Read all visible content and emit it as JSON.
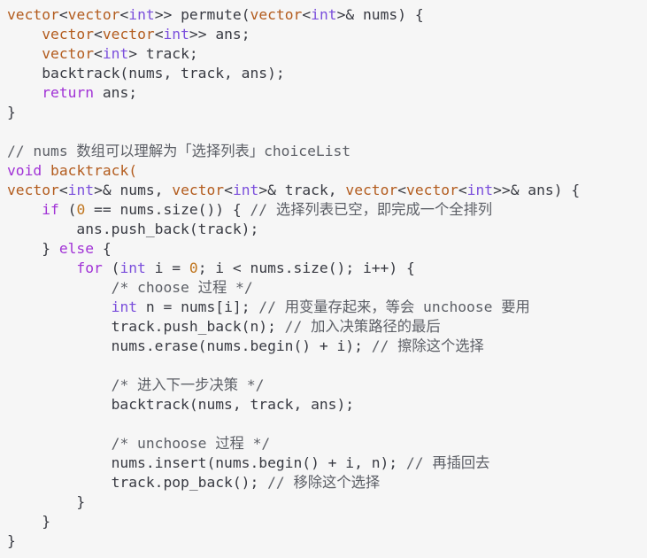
{
  "colors": {
    "background": "#f6f6f6",
    "type": "#b35c1e",
    "keyword": "#a132d6",
    "builtin": "#7b4fdc",
    "comment": "#5c5f66",
    "text": "#383a42",
    "number": "#c0761f"
  },
  "lines": [
    [
      {
        "t": "vector",
        "c": "type"
      },
      {
        "t": "<",
        "c": "plain"
      },
      {
        "t": "vector",
        "c": "type"
      },
      {
        "t": "<",
        "c": "plain"
      },
      {
        "t": "int",
        "c": "builtin"
      },
      {
        "t": ">> permute(",
        "c": "plain"
      },
      {
        "t": "vector",
        "c": "type"
      },
      {
        "t": "<",
        "c": "plain"
      },
      {
        "t": "int",
        "c": "builtin"
      },
      {
        "t": ">& nums) {",
        "c": "plain"
      }
    ],
    [
      {
        "t": "    ",
        "c": "plain"
      },
      {
        "t": "vector",
        "c": "type"
      },
      {
        "t": "<",
        "c": "plain"
      },
      {
        "t": "vector",
        "c": "type"
      },
      {
        "t": "<",
        "c": "plain"
      },
      {
        "t": "int",
        "c": "builtin"
      },
      {
        "t": ">> ans;",
        "c": "plain"
      }
    ],
    [
      {
        "t": "    ",
        "c": "plain"
      },
      {
        "t": "vector",
        "c": "type"
      },
      {
        "t": "<",
        "c": "plain"
      },
      {
        "t": "int",
        "c": "builtin"
      },
      {
        "t": "> track;",
        "c": "plain"
      }
    ],
    [
      {
        "t": "    backtrack(nums, track, ans);",
        "c": "plain"
      }
    ],
    [
      {
        "t": "    ",
        "c": "plain"
      },
      {
        "t": "return",
        "c": "kw"
      },
      {
        "t": " ans;",
        "c": "plain"
      }
    ],
    [
      {
        "t": "}",
        "c": "plain"
      }
    ],
    [],
    [
      {
        "t": "// nums 数组可以理解为「选择列表」choiceList",
        "c": "comment"
      }
    ],
    [
      {
        "t": "void",
        "c": "kw"
      },
      {
        "t": " ",
        "c": "plain"
      },
      {
        "t": "backtrack(",
        "c": "type"
      }
    ],
    [
      {
        "t": "vector",
        "c": "type"
      },
      {
        "t": "<",
        "c": "plain"
      },
      {
        "t": "int",
        "c": "builtin"
      },
      {
        "t": ">& nums, ",
        "c": "plain"
      },
      {
        "t": "vector",
        "c": "type"
      },
      {
        "t": "<",
        "c": "plain"
      },
      {
        "t": "int",
        "c": "builtin"
      },
      {
        "t": ">& track, ",
        "c": "plain"
      },
      {
        "t": "vector",
        "c": "type"
      },
      {
        "t": "<",
        "c": "plain"
      },
      {
        "t": "vector",
        "c": "type"
      },
      {
        "t": "<",
        "c": "plain"
      },
      {
        "t": "int",
        "c": "builtin"
      },
      {
        "t": ">>& ans) {",
        "c": "plain"
      }
    ],
    [
      {
        "t": "    ",
        "c": "plain"
      },
      {
        "t": "if",
        "c": "kw"
      },
      {
        "t": " (",
        "c": "plain"
      },
      {
        "t": "0",
        "c": "num"
      },
      {
        "t": " == nums.size()) { ",
        "c": "plain"
      },
      {
        "t": "// 选择列表已空，即完成一个全排列",
        "c": "comment"
      }
    ],
    [
      {
        "t": "        ans.push_back(track);",
        "c": "plain"
      }
    ],
    [
      {
        "t": "    } ",
        "c": "plain"
      },
      {
        "t": "else",
        "c": "kw"
      },
      {
        "t": " {",
        "c": "plain"
      }
    ],
    [
      {
        "t": "        ",
        "c": "plain"
      },
      {
        "t": "for",
        "c": "kw"
      },
      {
        "t": " (",
        "c": "plain"
      },
      {
        "t": "int",
        "c": "builtin"
      },
      {
        "t": " i = ",
        "c": "plain"
      },
      {
        "t": "0",
        "c": "num"
      },
      {
        "t": "; i < nums.size(); i++) {",
        "c": "plain"
      }
    ],
    [
      {
        "t": "            ",
        "c": "plain"
      },
      {
        "t": "/* choose 过程 */",
        "c": "comment"
      }
    ],
    [
      {
        "t": "            ",
        "c": "plain"
      },
      {
        "t": "int",
        "c": "builtin"
      },
      {
        "t": " n = nums[i]; ",
        "c": "plain"
      },
      {
        "t": "// 用变量存起来，等会 unchoose 要用",
        "c": "comment"
      }
    ],
    [
      {
        "t": "            track.push_back(n); ",
        "c": "plain"
      },
      {
        "t": "// 加入决策路径的最后",
        "c": "comment"
      }
    ],
    [
      {
        "t": "            nums.erase(nums.begin() + i); ",
        "c": "plain"
      },
      {
        "t": "// 擦除这个选择",
        "c": "comment"
      }
    ],
    [],
    [
      {
        "t": "            ",
        "c": "plain"
      },
      {
        "t": "/* 进入下一步决策 */",
        "c": "comment"
      }
    ],
    [
      {
        "t": "            backtrack(nums, track, ans);",
        "c": "plain"
      }
    ],
    [],
    [
      {
        "t": "            ",
        "c": "plain"
      },
      {
        "t": "/* unchoose 过程 */",
        "c": "comment"
      }
    ],
    [
      {
        "t": "            nums.insert(nums.begin() + i, n); ",
        "c": "plain"
      },
      {
        "t": "// 再插回去",
        "c": "comment"
      }
    ],
    [
      {
        "t": "            track.pop_back(); ",
        "c": "plain"
      },
      {
        "t": "// 移除这个选择",
        "c": "comment"
      }
    ],
    [
      {
        "t": "        }",
        "c": "plain"
      }
    ],
    [
      {
        "t": "    }",
        "c": "plain"
      }
    ],
    [
      {
        "t": "}",
        "c": "plain"
      }
    ]
  ]
}
